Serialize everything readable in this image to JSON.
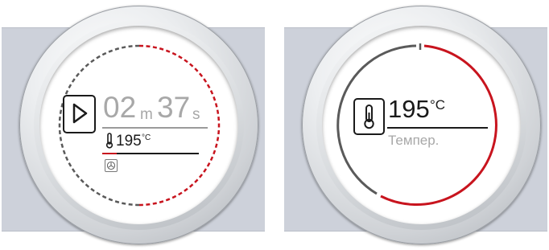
{
  "timer_screen": {
    "minutes": "02",
    "minutes_unit": "m",
    "seconds": "37",
    "seconds_unit": "s",
    "temperature": "195",
    "temperature_unit": "°C",
    "play_icon": "play-icon",
    "thermometer_icon": "thermometer-icon",
    "fan_mode_icon": "fan-mode-icon",
    "progress_fraction": 0.5
  },
  "temperature_screen": {
    "temperature": "195",
    "temperature_unit": "°C",
    "label": "Темпер.",
    "thermometer_icon": "thermometer-icon",
    "level_fraction": 0.45
  },
  "colors": {
    "accent_red": "#c8141e",
    "inactive_gray": "#5a5a5a",
    "text_dark": "#1a1a1a",
    "text_light": "#a8a8a8"
  }
}
